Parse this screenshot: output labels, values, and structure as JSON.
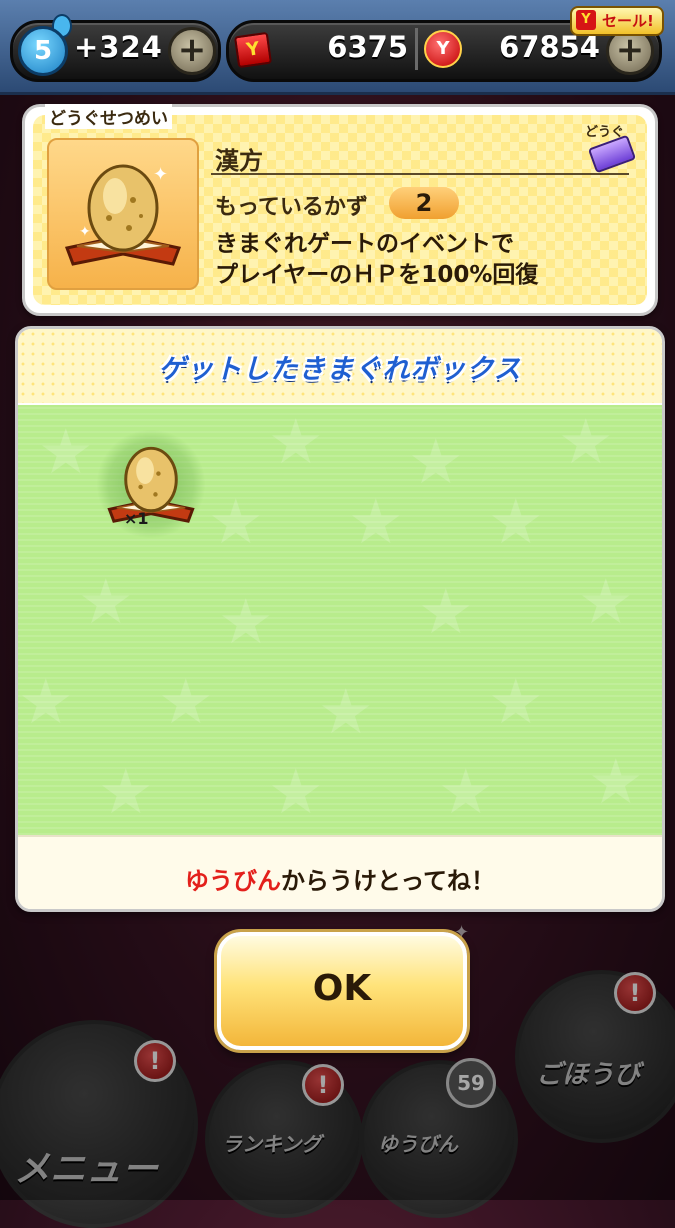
{
  "status_bar": {
    "level": "5",
    "stamina": "+324",
    "money": "6375",
    "coins": "67854",
    "sale_badge": "セール!",
    "plus_symbol": "+"
  },
  "item_description": {
    "section_label": "どうぐせつめい",
    "category_label": "どうぐ",
    "name": "漢方",
    "have_label": "もっているかず",
    "have_count": "2",
    "text_line1": "きまぐれゲートのイベントで",
    "text_line2": "プレイヤーのＨＰを100%回復"
  },
  "box_panel": {
    "title": "ゲットしたきまぐれボックス",
    "items": [
      {
        "icon": "kanpou-egg-icon",
        "quantity": "×1"
      }
    ],
    "footer_highlight": "ゆうびん",
    "footer_rest": "からうけとってね！"
  },
  "ok_button": {
    "label": "OK"
  },
  "background_nav": {
    "menu": "メニュー",
    "ranking": "ランキング",
    "mail": "ゆうびん",
    "mail_badge": "59",
    "reward": "ごほうび",
    "alert": "!"
  },
  "colors": {
    "accent_blue": "#1f5fd1",
    "highlight_red": "#e3201b",
    "panel_green": "#b8ec8c",
    "card_yellow": "#fff3b0"
  }
}
